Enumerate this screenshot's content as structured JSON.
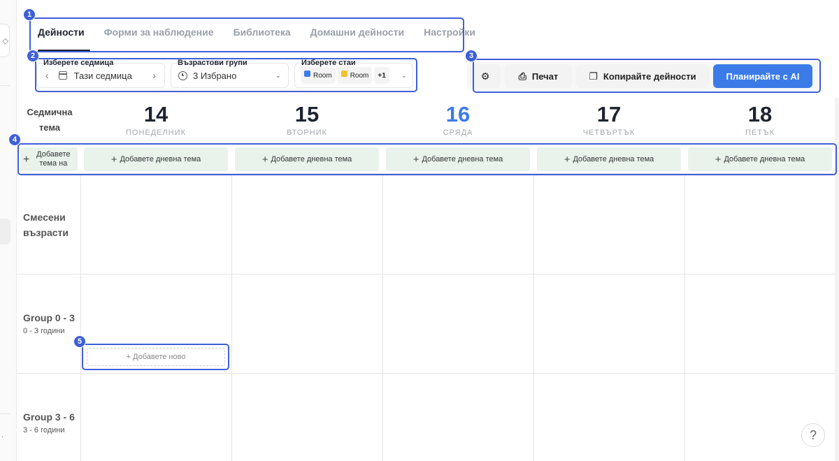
{
  "tabs": [
    {
      "label": "Дейности",
      "active": true
    },
    {
      "label": "Форми за наблюдение"
    },
    {
      "label": "Библиотека"
    },
    {
      "label": "Домашни дейности"
    },
    {
      "label": "Настройки"
    }
  ],
  "filters": {
    "week": {
      "label": "Изберете седмица",
      "value": "Тази седмица"
    },
    "age_groups": {
      "label": "Възрастови групи",
      "value": "3 Избрано"
    },
    "rooms": {
      "label": "Изберете стаи",
      "chips": [
        {
          "label": "Room",
          "color": "#3b7be8"
        },
        {
          "label": "Room",
          "color": "#f2c230"
        }
      ],
      "more": "+1"
    }
  },
  "actions": {
    "print": "Печат",
    "copy": "Копирайте дейности",
    "plan_ai": "Планирайте с AI"
  },
  "calendar": {
    "weekly_theme_label": "Седмична тема",
    "add_weekly_theme": "Добавете тема на",
    "add_daily_theme": "Добавете дневна тема",
    "days": [
      {
        "num": "14",
        "name": "ПОНЕДЕЛНИК"
      },
      {
        "num": "15",
        "name": "ВТОРНИК"
      },
      {
        "num": "16",
        "name": "СРЯДА",
        "today": true
      },
      {
        "num": "17",
        "name": "ЧЕТВЪРТЪК"
      },
      {
        "num": "18",
        "name": "ПЕТЪК"
      }
    ],
    "groups": [
      {
        "name": "Смесени възрасти",
        "sub": ""
      },
      {
        "name": "Group 0 - 3",
        "sub": "0 - 3 години"
      },
      {
        "name": "Group 3 - 6",
        "sub": "3 - 6 години"
      }
    ],
    "add_new": "+ Добавете ново"
  },
  "help": "?",
  "annotations": [
    "1",
    "2",
    "3",
    "4",
    "5"
  ],
  "colors": {
    "accent": "#3b7be8",
    "annotation": "#3f5fd8",
    "theme_bg": "#e9f3ec"
  }
}
